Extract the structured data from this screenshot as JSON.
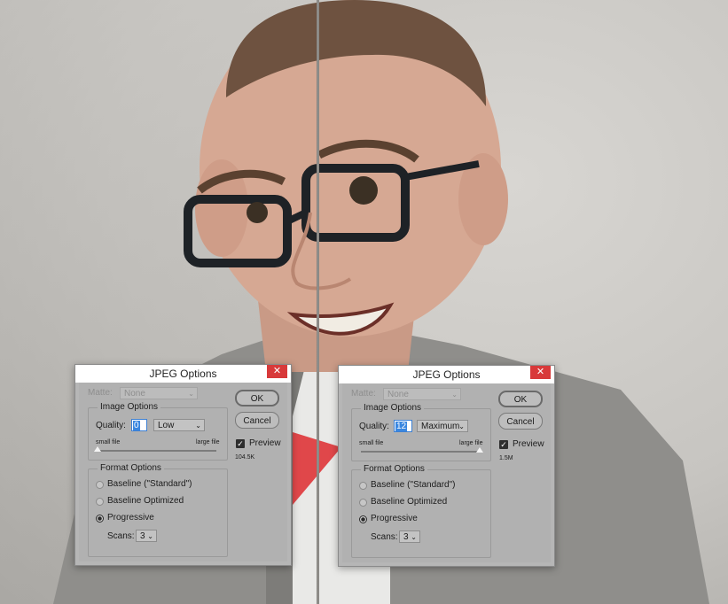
{
  "dialogs": [
    {
      "title": "JPEG Options",
      "close_glyph": "✕",
      "matte_label": "Matte:",
      "matte_value": "None",
      "image_options_legend": "Image Options",
      "quality_label": "Quality:",
      "quality_value": "0",
      "quality_preset": "Low",
      "small_file_label": "small file",
      "large_file_label": "large file",
      "quality_slider_level": 0.0,
      "ok_label": "OK",
      "cancel_label": "Cancel",
      "preview_label": "Preview",
      "preview_checked": true,
      "file_size": "104.5K",
      "format_options_legend": "Format Options",
      "format_baseline_standard": "Baseline (\"Standard\")",
      "format_baseline_optimized": "Baseline Optimized",
      "format_progressive": "Progressive",
      "format_selected": "progressive",
      "scans_label": "Scans:",
      "scans_value": "3"
    },
    {
      "title": "JPEG Options",
      "close_glyph": "✕",
      "matte_label": "Matte:",
      "matte_value": "None",
      "image_options_legend": "Image Options",
      "quality_label": "Quality:",
      "quality_value": "12",
      "quality_preset": "Maximum",
      "small_file_label": "small file",
      "large_file_label": "large file",
      "quality_slider_level": 1.0,
      "ok_label": "OK",
      "cancel_label": "Cancel",
      "preview_label": "Preview",
      "preview_checked": true,
      "file_size": "1.5M",
      "format_options_legend": "Format Options",
      "format_baseline_standard": "Baseline (\"Standard\")",
      "format_baseline_optimized": "Baseline Optimized",
      "format_progressive": "Progressive",
      "format_selected": "progressive",
      "scans_label": "Scans:",
      "scans_value": "3"
    }
  ],
  "colors": {
    "close_button": "#d8393a",
    "selection": "#3a87e0",
    "dialog_bg": "#b1b1b1"
  },
  "icons": {
    "close": "close-icon",
    "dropdown": "chevron-down-icon",
    "check": "checkmark-icon"
  }
}
